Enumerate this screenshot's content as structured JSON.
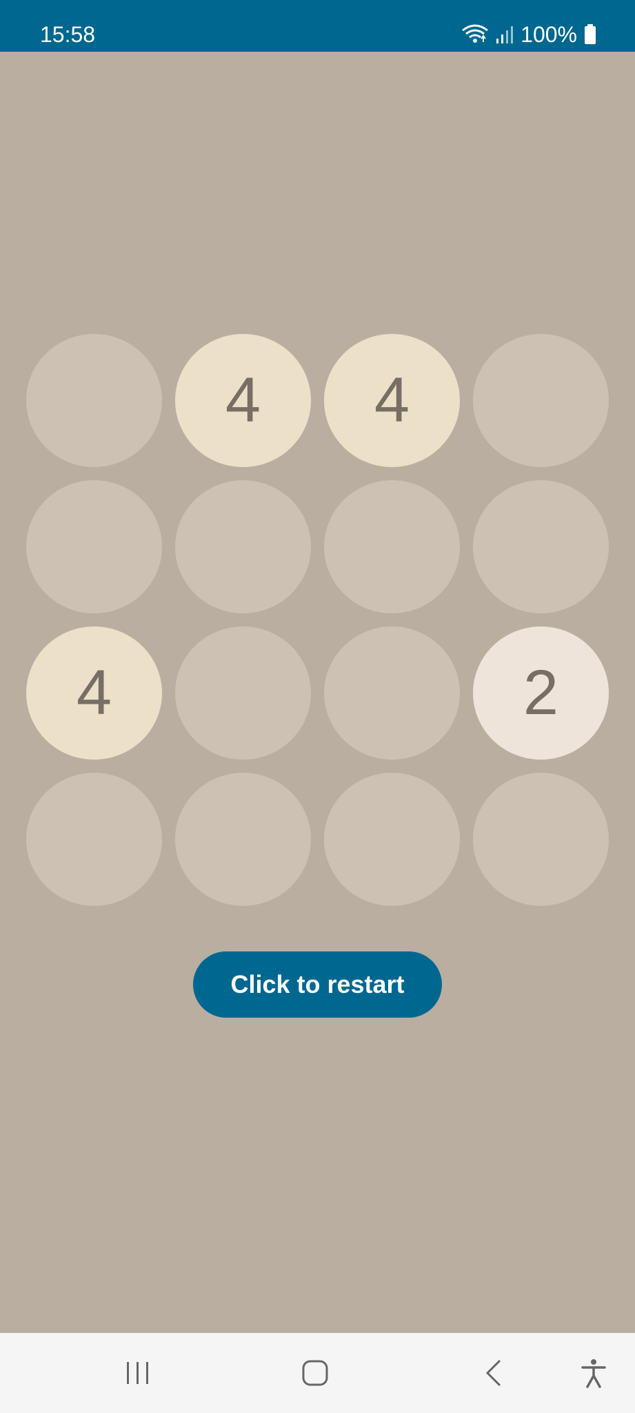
{
  "status_bar": {
    "time": "15:58",
    "battery": "100%",
    "icons": [
      "wifi-icon",
      "signal-icon",
      "battery-icon"
    ],
    "color": "#006890"
  },
  "board": {
    "rows": [
      [
        "",
        "4",
        "4",
        ""
      ],
      [
        "",
        "",
        "",
        ""
      ],
      [
        "4",
        "",
        "",
        "2"
      ],
      [
        "",
        "",
        "",
        ""
      ]
    ],
    "colors": {
      "empty": "#cdc1b4",
      "2": "#eee4da",
      "4": "#ede0c8",
      "text": "#776e65"
    }
  },
  "restart_button": {
    "label": "Click to restart"
  },
  "nav_bar": {
    "icons": [
      "recent-apps-icon",
      "home-icon",
      "back-icon",
      "accessibility-icon"
    ]
  }
}
